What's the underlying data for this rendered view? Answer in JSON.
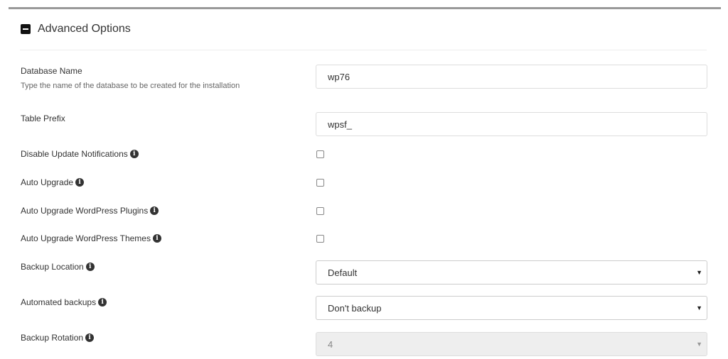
{
  "section": {
    "title": "Advanced Options",
    "toggle_icon": "minus-square-icon"
  },
  "fields": {
    "database_name": {
      "label": "Database Name",
      "hint": "Type the name of the database to be created for the installation",
      "value": "wp76"
    },
    "table_prefix": {
      "label": "Table Prefix",
      "value": "wpsf_"
    },
    "disable_update_notifications": {
      "label": "Disable Update Notifications",
      "checked": false
    },
    "auto_upgrade": {
      "label": "Auto Upgrade",
      "checked": false
    },
    "auto_upgrade_plugins": {
      "label": "Auto Upgrade WordPress Plugins",
      "checked": false
    },
    "auto_upgrade_themes": {
      "label": "Auto Upgrade WordPress Themes",
      "checked": false
    },
    "backup_location": {
      "label": "Backup Location",
      "selected": "Default"
    },
    "automated_backups": {
      "label": "Automated backups",
      "selected": "Don't backup"
    },
    "backup_rotation": {
      "label": "Backup Rotation",
      "selected": "4",
      "disabled": true
    }
  },
  "icons": {
    "info": "i",
    "dropdown_arrow": "▼"
  }
}
